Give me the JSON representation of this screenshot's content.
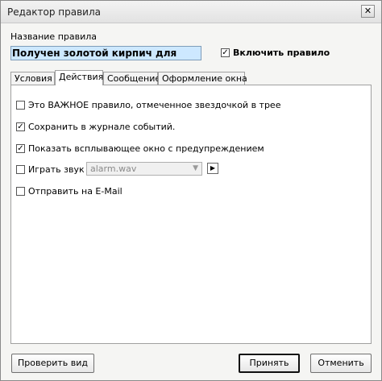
{
  "window": {
    "title": "Редактор правила",
    "close_icon": "close-icon"
  },
  "rule": {
    "name_label": "Название правила",
    "name_value": "Получен золотой кирпич для храма",
    "enable_label": "Включить правило",
    "enabled": true
  },
  "tabs": [
    {
      "label": "Условия"
    },
    {
      "label": "Действия"
    },
    {
      "label": "Сообщение"
    },
    {
      "label": "Оформление окна"
    }
  ],
  "active_tab": "Действия",
  "actions": {
    "important": {
      "label": "Это ВАЖНОЕ правило, отмеченное звездочкой в трее",
      "checked": false
    },
    "log": {
      "label": "Сохранить в журнале событий.",
      "checked": true
    },
    "popup": {
      "label": "Показать всплывающее окно с предупреждением",
      "checked": true
    },
    "sound": {
      "label": "Играть звук",
      "checked": false,
      "file": "alarm.wav"
    },
    "email": {
      "label": "Отправить на E-Mail",
      "checked": false
    }
  },
  "buttons": {
    "preview": "Проверить вид",
    "ok": "Принять",
    "cancel": "Отменить"
  }
}
